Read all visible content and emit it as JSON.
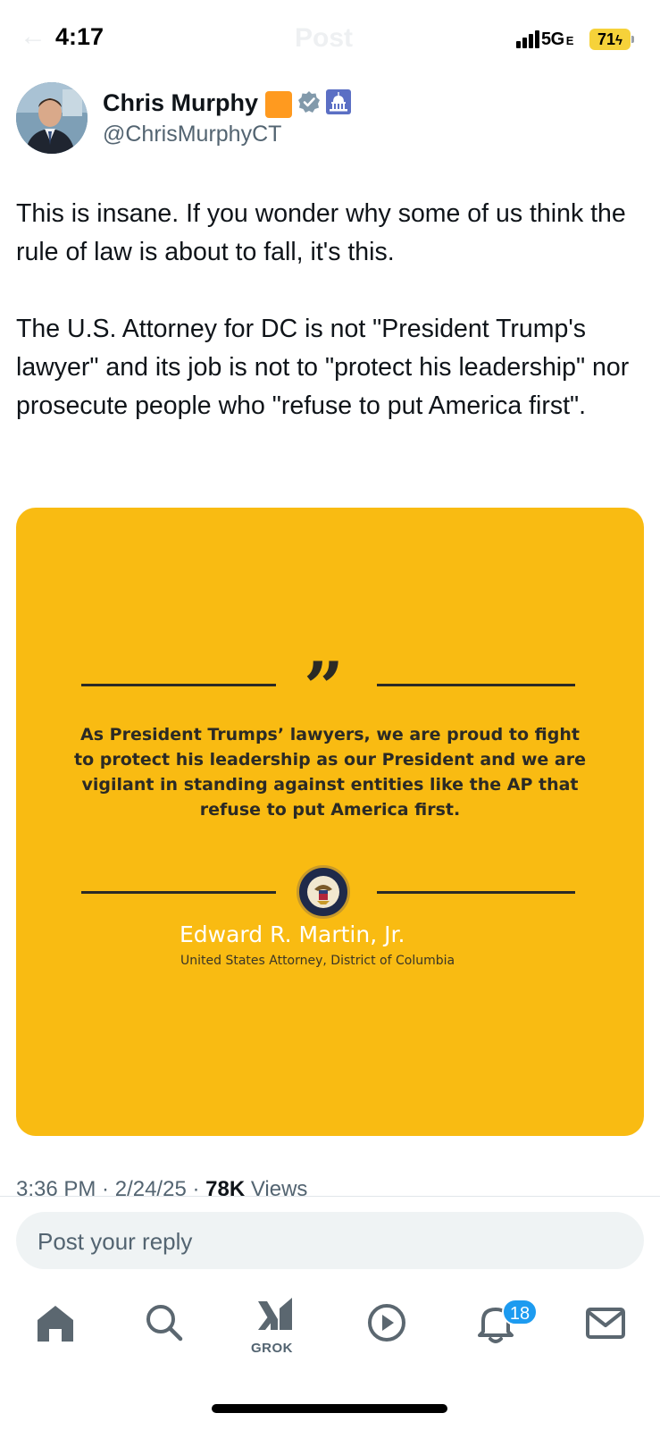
{
  "status_bar": {
    "time": "4:17",
    "network": "5G",
    "network_suffix": "E",
    "battery": "71",
    "ghost_title": "Post"
  },
  "author": {
    "name": "Chris Murphy",
    "handle": "@ChrisMurphyCT",
    "badges": [
      "orange-square",
      "verified-badge-icon",
      "capitol-building-icon"
    ]
  },
  "tweet": {
    "paragraphs": [
      "This is insane. If you wonder why some of us think the rule of law is about to fall, it's this.",
      "The U.S. Attorney for DC is not \"President Trump's lawyer\" and its job is not to \"protect his leadership\" nor prosecute people who \"refuse to put America first\"."
    ]
  },
  "media": {
    "quote_text": "As President Trumps’ lawyers, we are proud to fight to protect his leadership as our President and we are vigilant in standing against entities like the AP that refuse to put America first.",
    "signature_name": "Edward R. Martin, Jr.",
    "signature_title": "United States Attorney,  District of Columbia",
    "background_color": "#f9bb12"
  },
  "meta": {
    "time": "3:36 PM",
    "date": "2/24/25",
    "views_count": "78K",
    "views_label": "Views"
  },
  "reply": {
    "placeholder": "Post your reply"
  },
  "tab_bar": {
    "grok_label": "GROK",
    "notification_count": "18",
    "items": [
      "home-icon",
      "search-icon",
      "grok-icon",
      "video-icon",
      "notifications-icon",
      "messages-icon"
    ]
  },
  "colors": {
    "accent": "#1d9bf0",
    "muted_text": "#536471",
    "primary_text": "#0f1419"
  }
}
